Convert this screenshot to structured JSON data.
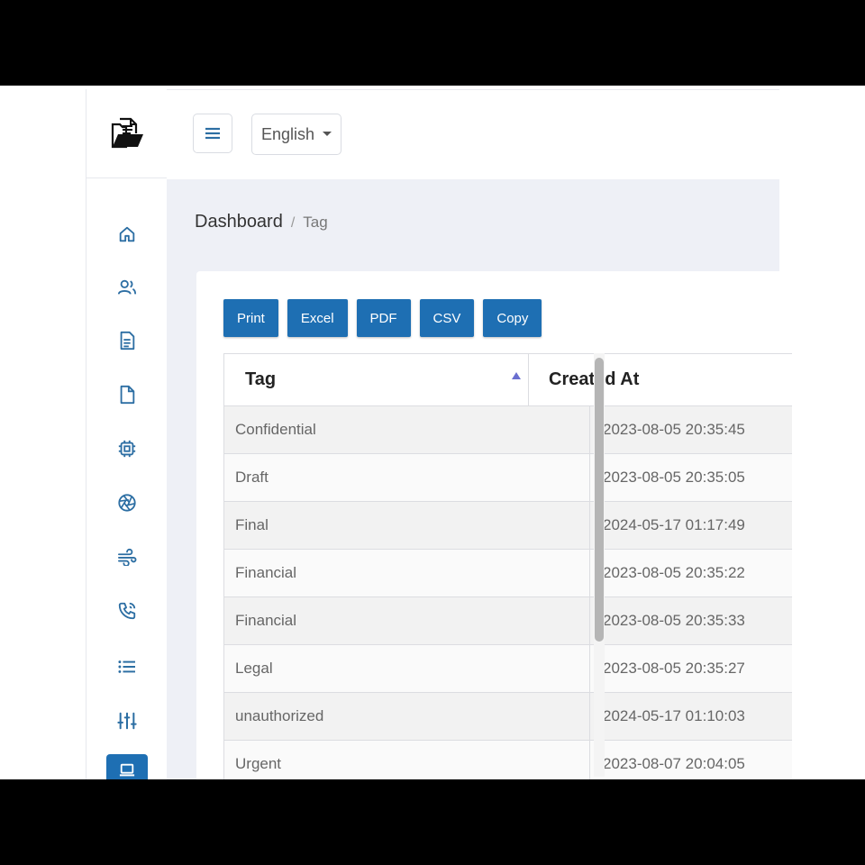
{
  "header": {
    "language": "English"
  },
  "breadcrumb": {
    "root": "Dashboard",
    "separator": "/",
    "current": "Tag"
  },
  "toolbar": {
    "buttons": [
      "Print",
      "Excel",
      "PDF",
      "CSV",
      "Copy"
    ]
  },
  "table": {
    "columns": [
      "Tag",
      "Created At"
    ],
    "sort": "ascending",
    "rows": [
      {
        "tag": "Confidential",
        "created_at": "2023-08-05 20:35:45"
      },
      {
        "tag": "Draft",
        "created_at": "2023-08-05 20:35:05"
      },
      {
        "tag": "Final",
        "created_at": "2024-05-17 01:17:49"
      },
      {
        "tag": "Financial",
        "created_at": "2023-08-05 20:35:22"
      },
      {
        "tag": "Financial",
        "created_at": "2023-08-05 20:35:33"
      },
      {
        "tag": "Legal",
        "created_at": "2023-08-05 20:35:27"
      },
      {
        "tag": "unauthorized",
        "created_at": "2024-05-17 01:10:03"
      },
      {
        "tag": "Urgent",
        "created_at": "2023-08-07 20:04:05"
      }
    ]
  },
  "sidebar": {
    "items": [
      {
        "icon": "home-icon"
      },
      {
        "icon": "users-icon"
      },
      {
        "icon": "document-text-icon"
      },
      {
        "icon": "file-icon"
      },
      {
        "icon": "cpu-chip-icon"
      },
      {
        "icon": "aperture-icon"
      },
      {
        "icon": "wind-icon"
      },
      {
        "icon": "phone-call-icon"
      },
      {
        "icon": "list-icon"
      },
      {
        "icon": "sliders-icon"
      },
      {
        "icon": "laptop-icon",
        "active": true
      }
    ]
  },
  "colors": {
    "accent": "#1e6fb3",
    "icon": "#2c6ea3",
    "content_bg": "#eef0f6"
  }
}
